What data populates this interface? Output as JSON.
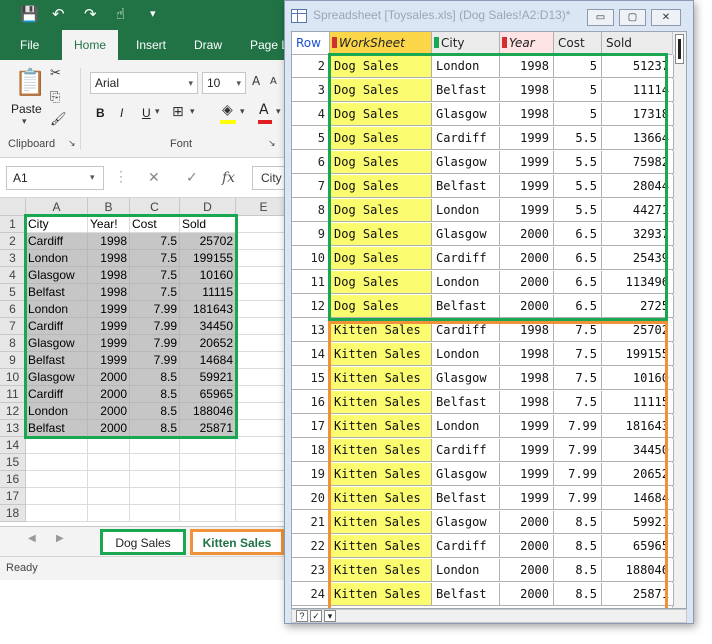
{
  "excel": {
    "ribbon_tabs": [
      "File",
      "Home",
      "Insert",
      "Draw",
      "Page L"
    ],
    "clipboard": {
      "paste_label": "Paste",
      "group_label": "Clipboard"
    },
    "font": {
      "name": "Arial",
      "size": "10",
      "group_label": "Font",
      "bold": "B",
      "italic": "I",
      "underline": "U"
    },
    "formula_bar": {
      "name_box": "A1",
      "cancel": "✕",
      "enter": "✓",
      "fx": "fx",
      "content": "City"
    },
    "columns": [
      "A",
      "B",
      "C",
      "D",
      "E"
    ],
    "header_row": [
      "City",
      "Year!",
      "Cost",
      "Sold"
    ],
    "rows": [
      [
        "Cardiff",
        "1998",
        "7.5",
        "25702"
      ],
      [
        "London",
        "1998",
        "7.5",
        "199155"
      ],
      [
        "Glasgow",
        "1998",
        "7.5",
        "10160"
      ],
      [
        "Belfast",
        "1998",
        "7.5",
        "11115"
      ],
      [
        "London",
        "1999",
        "7.99",
        "181643"
      ],
      [
        "Cardiff",
        "1999",
        "7.99",
        "34450"
      ],
      [
        "Glasgow",
        "1999",
        "7.99",
        "20652"
      ],
      [
        "Belfast",
        "1999",
        "7.99",
        "14684"
      ],
      [
        "Glasgow",
        "2000",
        "8.5",
        "59921"
      ],
      [
        "Cardiff",
        "2000",
        "8.5",
        "65965"
      ],
      [
        "London",
        "2000",
        "8.5",
        "188046"
      ],
      [
        "Belfast",
        "2000",
        "8.5",
        "25871"
      ]
    ],
    "row_numbers": [
      "1",
      "2",
      "3",
      "4",
      "5",
      "6",
      "7",
      "8",
      "9",
      "10",
      "11",
      "12",
      "13",
      "14",
      "15",
      "16",
      "17",
      "18"
    ],
    "sheet_tabs": [
      "Dog Sales",
      "Kitten Sales"
    ],
    "status": "Ready"
  },
  "spreadsheet": {
    "title": "Spreadsheet [Toysales.xls] (Dog Sales!A2:D13)*",
    "window_buttons": {
      "minimize": "▭",
      "maximize": "▢",
      "close": "✕"
    },
    "headers": [
      "Row",
      "WorkSheet",
      "City",
      "Year",
      "Cost",
      "Sold"
    ],
    "rows": [
      [
        "2",
        "Dog Sales",
        "London",
        "1998",
        "5",
        "51237"
      ],
      [
        "3",
        "Dog Sales",
        "Belfast",
        "1998",
        "5",
        "11114"
      ],
      [
        "4",
        "Dog Sales",
        "Glasgow",
        "1998",
        "5",
        "17318"
      ],
      [
        "5",
        "Dog Sales",
        "Cardiff",
        "1999",
        "5.5",
        "13664"
      ],
      [
        "6",
        "Dog Sales",
        "Glasgow",
        "1999",
        "5.5",
        "75982"
      ],
      [
        "7",
        "Dog Sales",
        "Belfast",
        "1999",
        "5.5",
        "28044"
      ],
      [
        "8",
        "Dog Sales",
        "London",
        "1999",
        "5.5",
        "44271"
      ],
      [
        "9",
        "Dog Sales",
        "Glasgow",
        "2000",
        "6.5",
        "32937"
      ],
      [
        "10",
        "Dog Sales",
        "Cardiff",
        "2000",
        "6.5",
        "25439"
      ],
      [
        "11",
        "Dog Sales",
        "London",
        "2000",
        "6.5",
        "113496"
      ],
      [
        "12",
        "Dog Sales",
        "Belfast",
        "2000",
        "6.5",
        "2725"
      ],
      [
        "13",
        "Kitten Sales",
        "Cardiff",
        "1998",
        "7.5",
        "25702"
      ],
      [
        "14",
        "Kitten Sales",
        "London",
        "1998",
        "7.5",
        "199155"
      ],
      [
        "15",
        "Kitten Sales",
        "Glasgow",
        "1998",
        "7.5",
        "10160"
      ],
      [
        "16",
        "Kitten Sales",
        "Belfast",
        "1998",
        "7.5",
        "11115"
      ],
      [
        "17",
        "Kitten Sales",
        "London",
        "1999",
        "7.99",
        "181643"
      ],
      [
        "18",
        "Kitten Sales",
        "Cardiff",
        "1999",
        "7.99",
        "34450"
      ],
      [
        "19",
        "Kitten Sales",
        "Glasgow",
        "1999",
        "7.99",
        "20652"
      ],
      [
        "20",
        "Kitten Sales",
        "Belfast",
        "1999",
        "7.99",
        "14684"
      ],
      [
        "21",
        "Kitten Sales",
        "Glasgow",
        "2000",
        "8.5",
        "59921"
      ],
      [
        "22",
        "Kitten Sales",
        "Cardiff",
        "2000",
        "8.5",
        "65965"
      ],
      [
        "23",
        "Kitten Sales",
        "London",
        "2000",
        "8.5",
        "188046"
      ],
      [
        "24",
        "Kitten Sales",
        "Belfast",
        "2000",
        "8.5",
        "25871"
      ]
    ],
    "footer_buttons": [
      "?"
    ]
  },
  "colors": {
    "excel_green": "#217346",
    "dog_outline": "#1aa752",
    "kitten_outline": "#f0923a",
    "worksheet_header": "#fcd649",
    "worksheet_cells": "#fbfb70"
  }
}
